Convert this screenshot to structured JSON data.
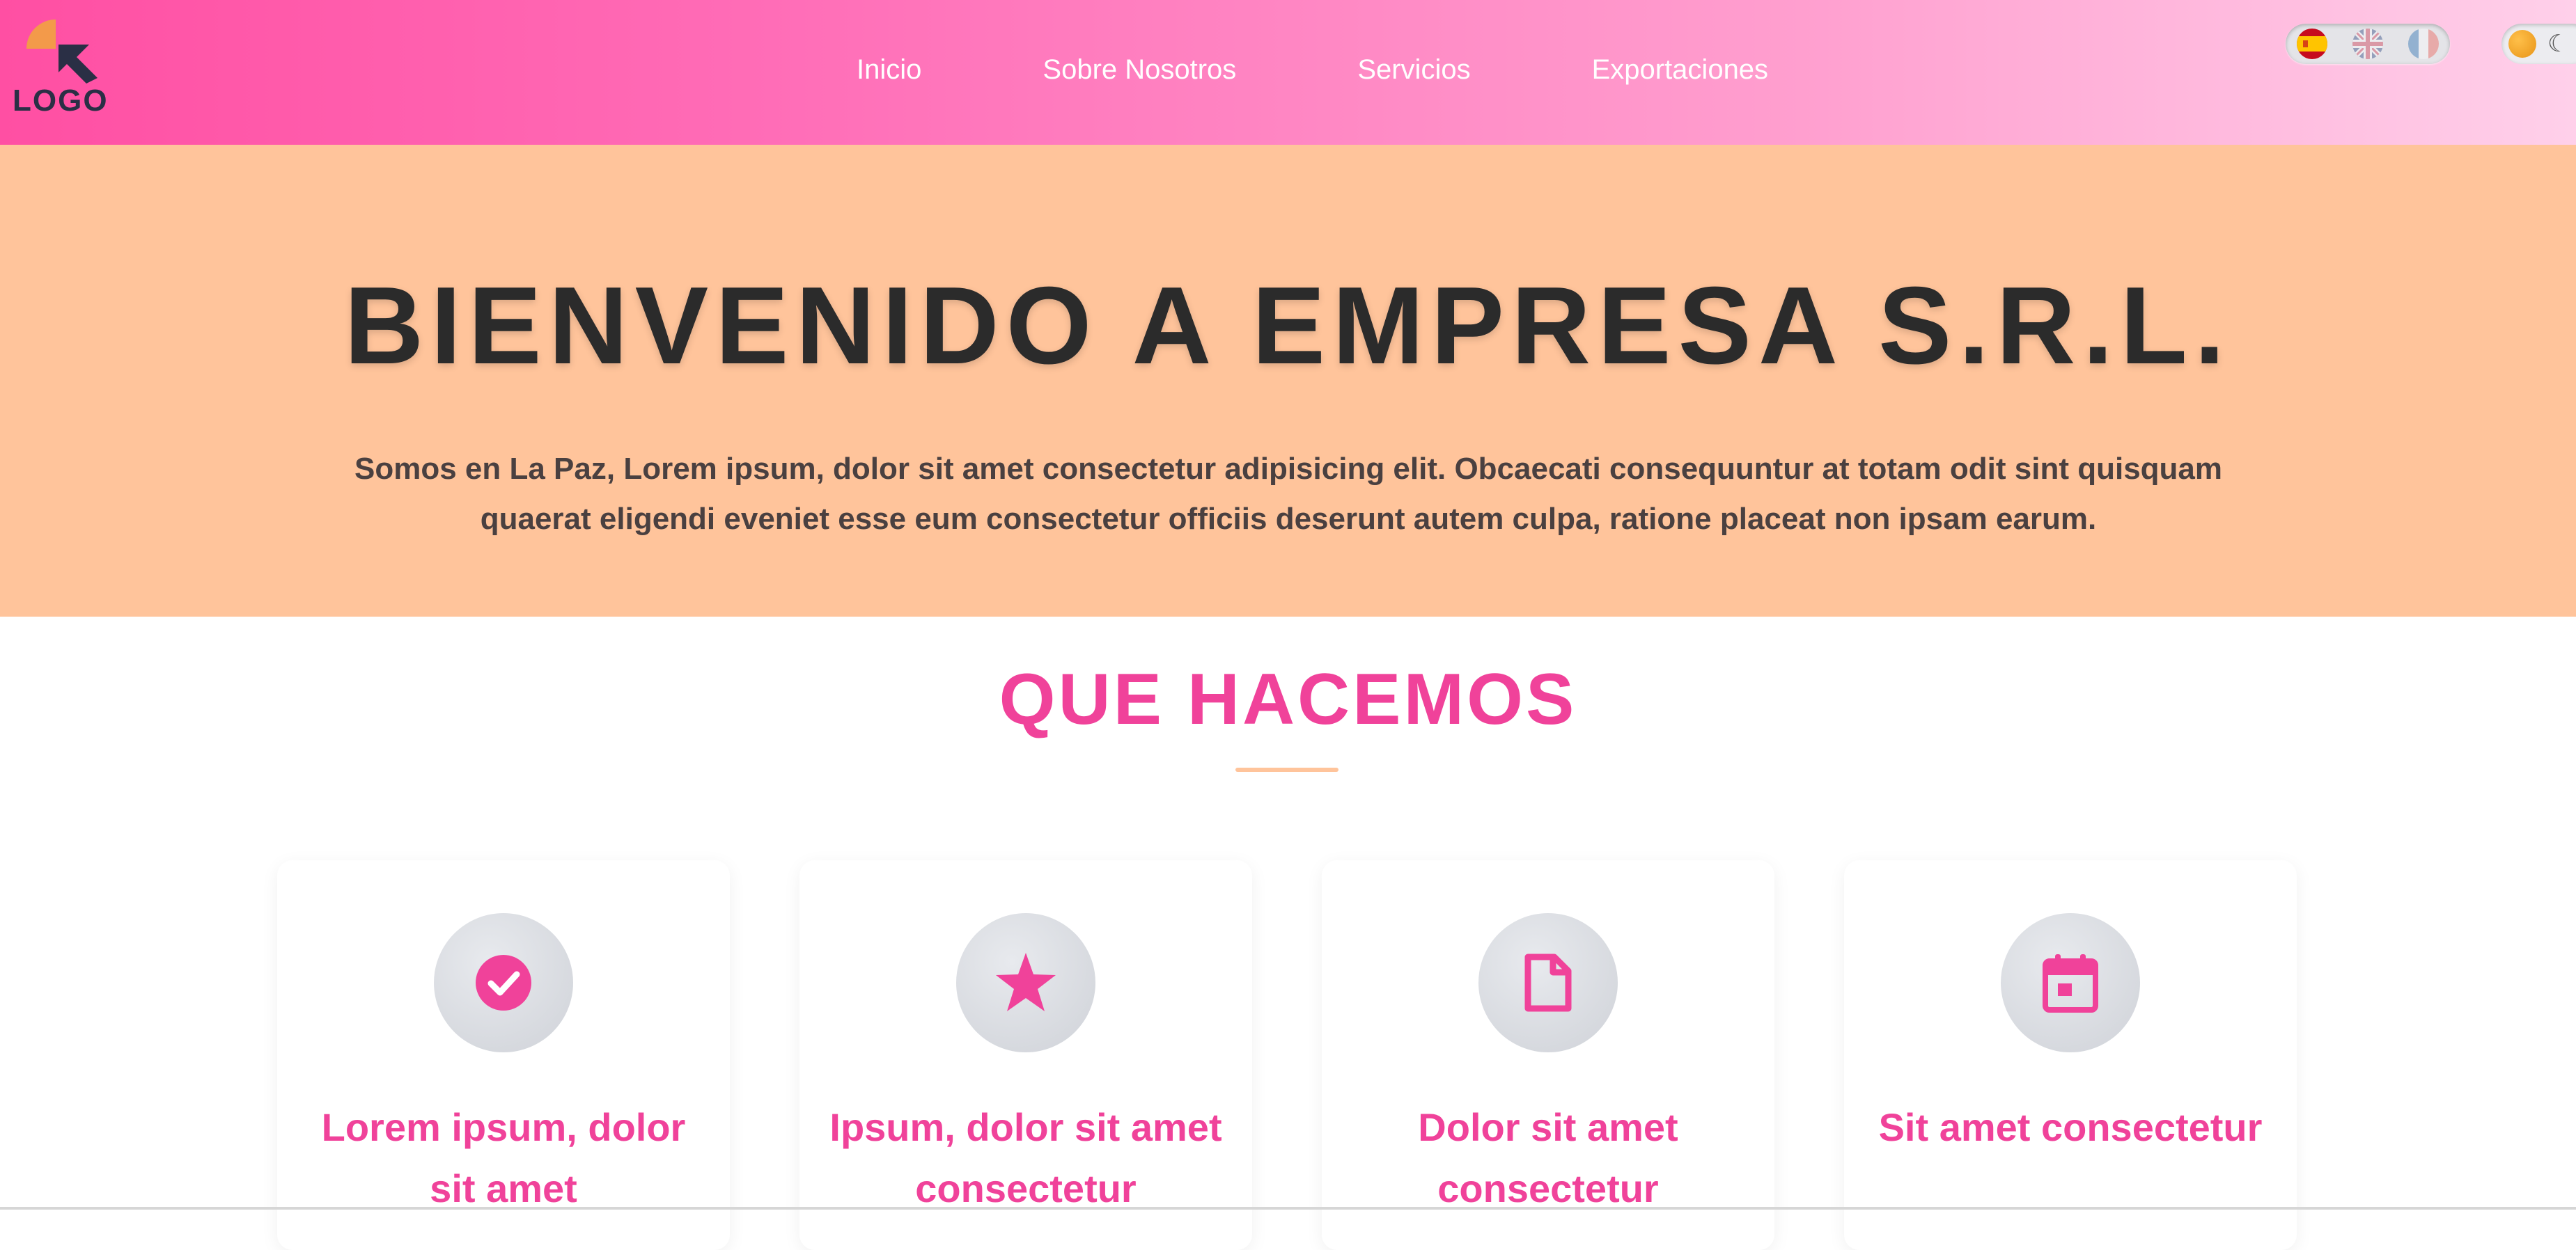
{
  "header": {
    "logo_text": "LOGO",
    "nav": [
      {
        "label": "Inicio"
      },
      {
        "label": "Sobre Nosotros"
      },
      {
        "label": "Servicios"
      },
      {
        "label": "Exportaciones"
      }
    ],
    "language_switch": {
      "selected": "es",
      "options": [
        "es-flag-icon",
        "gb-flag-icon",
        "fr-flag-icon"
      ]
    },
    "theme_switch": {
      "icons": [
        "sun-icon",
        "moon-icon"
      ]
    },
    "colors": {
      "gradient_start": "#ff4fa3",
      "gradient_end": "#ffd0ea"
    }
  },
  "hero": {
    "title": "BIENVENIDO A EMPRESA S.R.L.",
    "text": "Somos en La Paz, Lorem ipsum, dolor sit amet consectetur adipisicing elit. Obcaecati consequuntur at totam odit sint quisquam quaerat eligendi eveniet esse eum consectetur officiis deserunt autem culpa, ratione placeat non ipsam earum.",
    "background": "#ffc49b"
  },
  "services": {
    "title": "QUE HACEMOS",
    "accent": "#f0429a",
    "cards": [
      {
        "icon": "check-circle-icon",
        "title": "Lorem ipsum, dolor sit amet"
      },
      {
        "icon": "star-icon",
        "title": "Ipsum, dolor sit amet consectetur"
      },
      {
        "icon": "document-icon",
        "title": "Dolor sit amet consectetur"
      },
      {
        "icon": "calendar-icon",
        "title": "Sit amet consectetur"
      }
    ]
  }
}
